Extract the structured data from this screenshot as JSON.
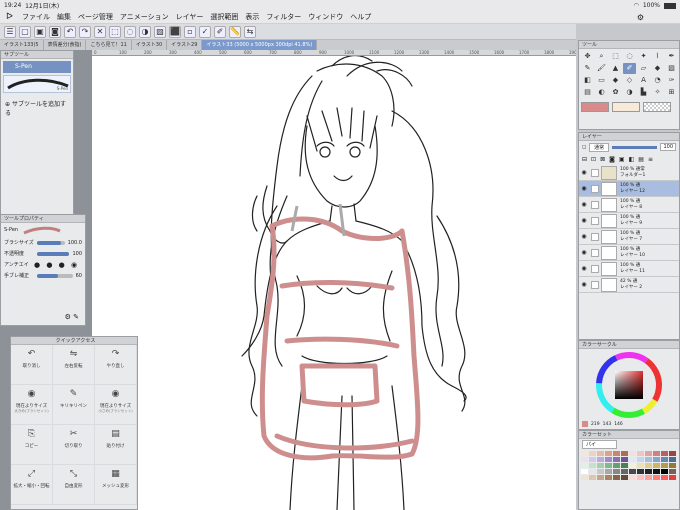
{
  "status": {
    "time": "19:24",
    "date": "12月1日(木)",
    "battery": "100%"
  },
  "menu": [
    "ファイル",
    "編集",
    "ページ管理",
    "アニメーション",
    "レイヤー",
    "選択範囲",
    "表示",
    "フィルター",
    "ウィンドウ",
    "ヘルプ"
  ],
  "tabs": [
    {
      "label": "イラスト133(5",
      "active": false
    },
    {
      "label": "表情差分(食指)",
      "active": false
    },
    {
      "label": "こちら見て！11",
      "active": false
    },
    {
      "label": "イラスト30",
      "active": false
    },
    {
      "label": "イラスト29",
      "active": false
    },
    {
      "label": "イラスト33 (5000 x 5000px 300dpi 41.8%)",
      "active": true
    }
  ],
  "subtool": {
    "title": "サブツール",
    "item": "S-Pen",
    "preview": "S-Pen",
    "add": "サブツールを追加する"
  },
  "toolprop": {
    "title": "ツールプロパティ",
    "brush": "S-Pen",
    "rows": [
      {
        "label": "ブラシサイズ",
        "value": "100.0",
        "pct": 0.85
      },
      {
        "label": "不透明度",
        "value": "100",
        "pct": 1.0
      },
      {
        "label": "アンチエイ",
        "value": "",
        "pct": 0
      },
      {
        "label": "手ブレ補正",
        "value": "60",
        "pct": 0.6
      }
    ]
  },
  "quick": {
    "title": "クイックアクセス",
    "items": [
      {
        "icon": "↶",
        "label": "取り消し",
        "sub": ""
      },
      {
        "icon": "⇋",
        "label": "左右反転",
        "sub": ""
      },
      {
        "icon": "↷",
        "label": "やり直し",
        "sub": ""
      },
      {
        "icon": "◉",
        "label": "現在よりサイズ",
        "sub": "大きめ(ブラシセット)"
      },
      {
        "icon": "✎",
        "label": "キリキリペン",
        "sub": ""
      },
      {
        "icon": "◉",
        "label": "現在よりサイズ",
        "sub": "小さめ(ブラシセット)"
      },
      {
        "icon": "⎘",
        "label": "コピー",
        "sub": ""
      },
      {
        "icon": "✂",
        "label": "切り取り",
        "sub": ""
      },
      {
        "icon": "▤",
        "label": "貼り付け",
        "sub": ""
      },
      {
        "icon": "⤢",
        "label": "拡大・縮小・回転",
        "sub": ""
      },
      {
        "icon": "⤡",
        "label": "自由変形",
        "sub": ""
      },
      {
        "icon": "▦",
        "label": "メッシュ変形",
        "sub": ""
      }
    ]
  },
  "toolpanel": {
    "title": "ツール",
    "colors": {
      "main": "#d98b8b",
      "sub": "#f8ead8"
    }
  },
  "layers": {
    "title": "レイヤー",
    "blend": "通常",
    "opacity": "100",
    "rows": [
      {
        "l1": "100 % 通常",
        "l2": "フォルダー1",
        "sel": false,
        "folder": true
      },
      {
        "l1": "100 % 通",
        "l2": "レイヤー 12",
        "sel": true,
        "folder": false
      },
      {
        "l1": "100 % 通",
        "l2": "レイヤー 8",
        "sel": false,
        "folder": false
      },
      {
        "l1": "100 % 通",
        "l2": "レイヤー 9",
        "sel": false,
        "folder": false
      },
      {
        "l1": "100 % 通",
        "l2": "レイヤー 7",
        "sel": false,
        "folder": false
      },
      {
        "l1": "100 % 通",
        "l2": "レイヤー 10",
        "sel": false,
        "folder": false
      },
      {
        "l1": "100 % 通",
        "l2": "レイヤー 11",
        "sel": false,
        "folder": false
      },
      {
        "l1": "42 % 通",
        "l2": "レイヤー 2",
        "sel": false,
        "folder": false
      }
    ]
  },
  "colorcircle": {
    "title": "カラーサークル",
    "h": "219",
    "s": "143",
    "v": "146"
  },
  "colorset": {
    "title": "カラーセット",
    "name": "パイ"
  },
  "ruler_ticks": [
    "0",
    "100",
    "200",
    "300",
    "400",
    "500",
    "600",
    "700",
    "800",
    "900",
    "1000",
    "1100",
    "1200",
    "1300",
    "1400",
    "1500",
    "1600",
    "1700",
    "1800",
    "1900"
  ]
}
